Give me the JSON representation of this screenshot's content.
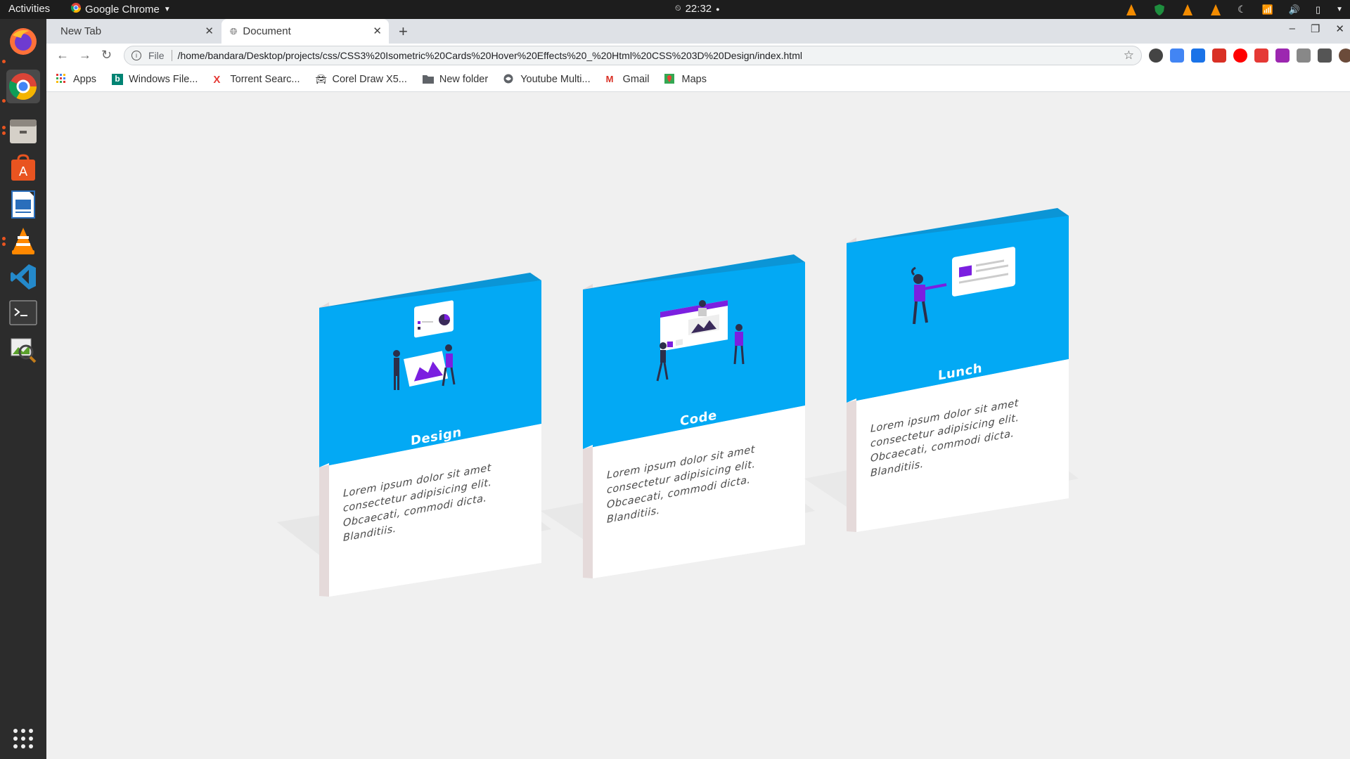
{
  "topbar": {
    "activities": "Activities",
    "app_name": "Google Chrome",
    "clock": "22:32"
  },
  "dock": {
    "apps": [
      "firefox-icon",
      "chrome-icon",
      "files-icon",
      "software-center-icon",
      "writer-icon",
      "vlc-icon",
      "vscode-icon",
      "terminal-icon",
      "image-viewer-icon"
    ]
  },
  "browser": {
    "tabs": [
      {
        "label": "New Tab"
      },
      {
        "label": "Document"
      }
    ],
    "scheme": "File",
    "url": "/home/bandara/Desktop/projects/css/CSS3%20Isometric%20Cards%20Hover%20Effects%20_%20Html%20CSS%203D%20Design/index.html",
    "bookmarks": [
      {
        "label": "Apps"
      },
      {
        "label": "Windows File..."
      },
      {
        "label": "Torrent Searc..."
      },
      {
        "label": "Corel Draw X5..."
      },
      {
        "label": "New folder"
      },
      {
        "label": "Youtube Multi..."
      },
      {
        "label": "Gmail"
      },
      {
        "label": "Maps"
      }
    ]
  },
  "cards": [
    {
      "title": "Design",
      "text": "Lorem ipsum dolor sit amet consectetur adipisicing elit. Obcaecati, commodi dicta. Blanditiis."
    },
    {
      "title": "Code",
      "text": "Lorem ipsum dolor sit amet consectetur adipisicing elit. Obcaecati, commodi dicta. Blanditiis."
    },
    {
      "title": "Lunch",
      "text": "Lorem ipsum dolor sit amet consectetur adipisicing elit. Obcaecati, commodi dicta. Blanditiis."
    }
  ],
  "colors": {
    "card_blue": "#03a9f4",
    "card_blue_top": "#0b95d6",
    "card_side": "#e6dcdc",
    "accent_purple": "#7b1fe0"
  }
}
